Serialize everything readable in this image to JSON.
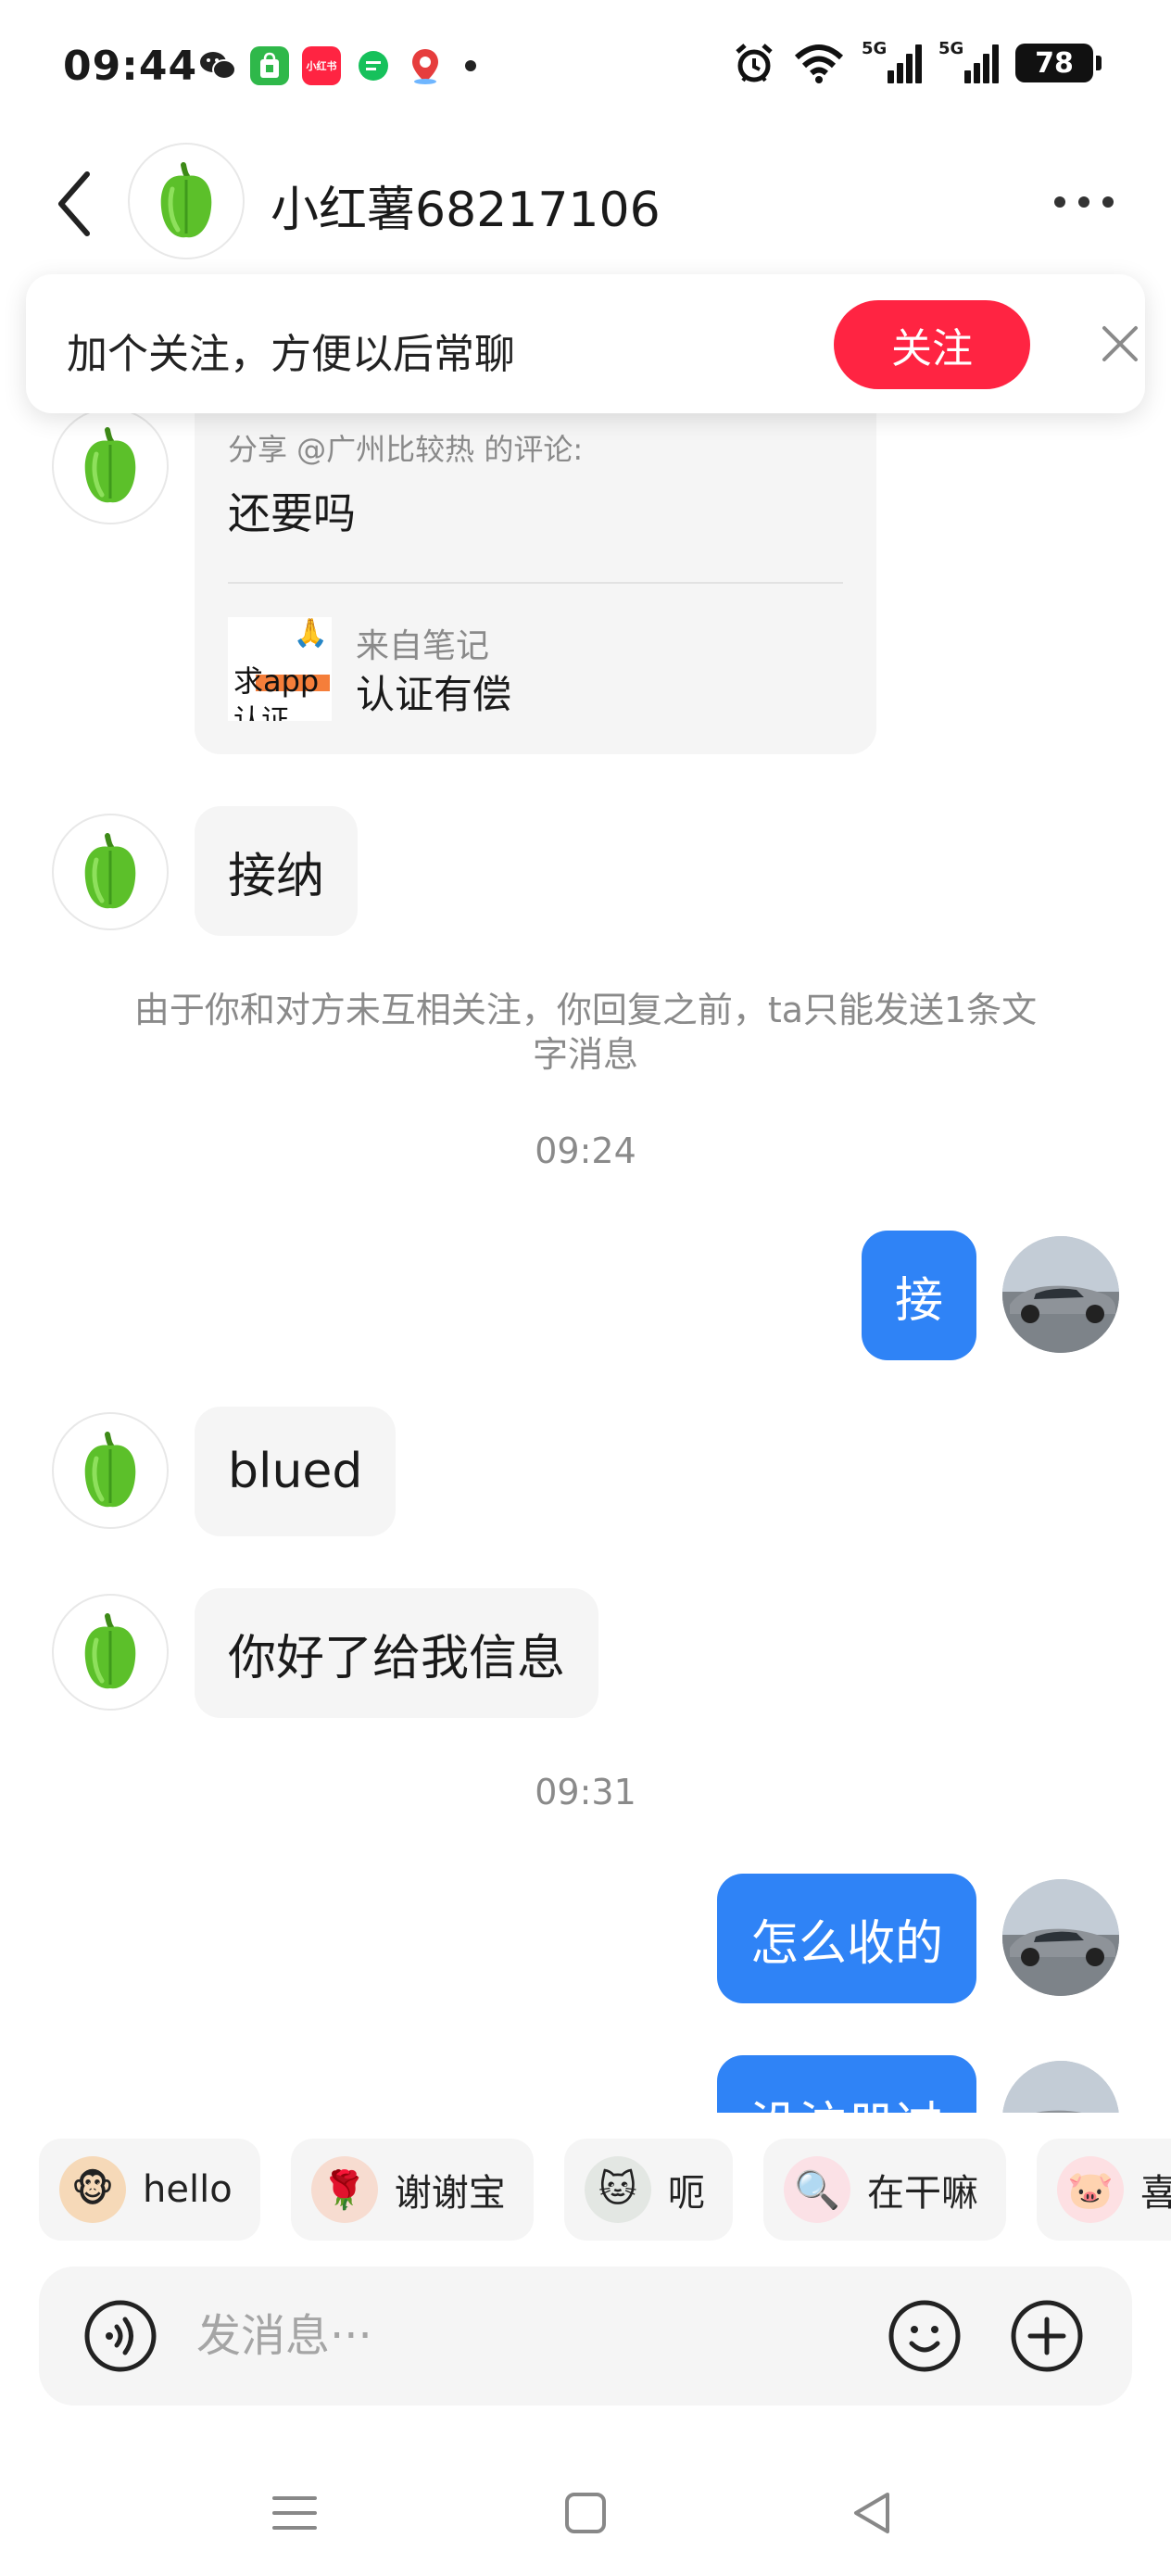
{
  "status_bar": {
    "time": "09:44",
    "app_icons": [
      {
        "icon": "wechat-icon",
        "color": "#222222"
      },
      {
        "icon": "app-store-icon",
        "color": "#2fb84a"
      },
      {
        "icon": "xiaohongshu-icon",
        "color": "#ff2442",
        "text": "小红书"
      },
      {
        "icon": "message-icon",
        "color": "#16c15b"
      },
      {
        "icon": "location-app-icon",
        "color": "#e63d3d"
      }
    ],
    "signal_1": "5G",
    "signal_2": "5G",
    "battery": "78"
  },
  "header": {
    "contact_name": "小红薯68217106"
  },
  "follow_banner": {
    "text": "加个关注，方便以后常聊",
    "follow_label": "关注"
  },
  "messages": {
    "share": {
      "caption": "分享 @广州比较热 的评论:",
      "comment": "还要吗",
      "source_label": "来自笔记",
      "note_title": "认证有偿",
      "thumb_text_1": "求app",
      "thumb_text_2": "认证",
      "thumb_emoji": "🙏"
    },
    "m1": "接纳",
    "system_note": "由于你和对方未互相关注，你回复之前，ta只能发送1条文字消息",
    "time_1": "09:24",
    "m2": "接",
    "m3": "blued",
    "m4": "你好了给我信息",
    "time_2": "09:31",
    "m5": "怎么收的",
    "m6": "没注册过"
  },
  "quick_replies": [
    {
      "label": "hello",
      "icon": "monkey-sticker-icon",
      "emoji": "🐵"
    },
    {
      "label": "谢谢宝",
      "icon": "girl-rose-sticker-icon",
      "emoji": "🌹"
    },
    {
      "label": "呃",
      "icon": "cat-sticker-icon",
      "emoji": "🐱"
    },
    {
      "label": "在干嘛",
      "icon": "magnifier-sticker-icon",
      "emoji": "🔍"
    },
    {
      "label": "喜",
      "icon": "pig-sticker-icon",
      "emoji": "🐷"
    }
  ],
  "input": {
    "placeholder": "发消息···"
  },
  "colors": {
    "accent": "#ff2442",
    "outgoing_bubble": "#2f83f6",
    "incoming_bubble": "#f5f5f5"
  }
}
